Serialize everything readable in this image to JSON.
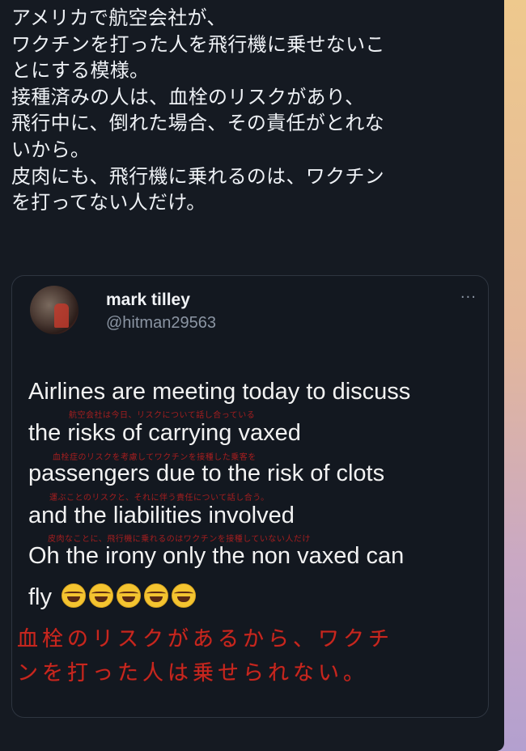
{
  "post": {
    "lines": [
      "アメリカで航空会社が、",
      "ワクチンを打った人を飛行機に乗せないこ",
      "とにする模様。",
      "接種済みの人は、血栓のリスクがあり、",
      "飛行中に、倒れた場合、その責任がとれな",
      "いから。",
      "皮肉にも、飛行機に乗れるのは、ワクチン",
      "を打ってない人だけ。"
    ]
  },
  "quoted": {
    "name": "mark tilley",
    "handle": "@hitman29563",
    "more": "···",
    "lines": [
      "Airlines are meeting today to discuss",
      "the risks of carrying vaxed",
      "passengers due to the risk of clots",
      "and the liabilities involved",
      "Oh the irony only the non vaxed can",
      "fly"
    ],
    "subtitles": [
      "航空会社は今日、リスクについて話し合っている",
      "血栓症のリスクを考慮してワクチンを接種した乗客を",
      "運ぶことのリスクと、それに伴う責任について話し合う。",
      "皮肉なことに、飛行機に乗れるのはワクチンを接種していない人だけ"
    ],
    "emoji_count": 5,
    "overlay": [
      "血栓のリスクがあるから、ワクチ",
      "ンを打った人は乗せられない。"
    ]
  }
}
